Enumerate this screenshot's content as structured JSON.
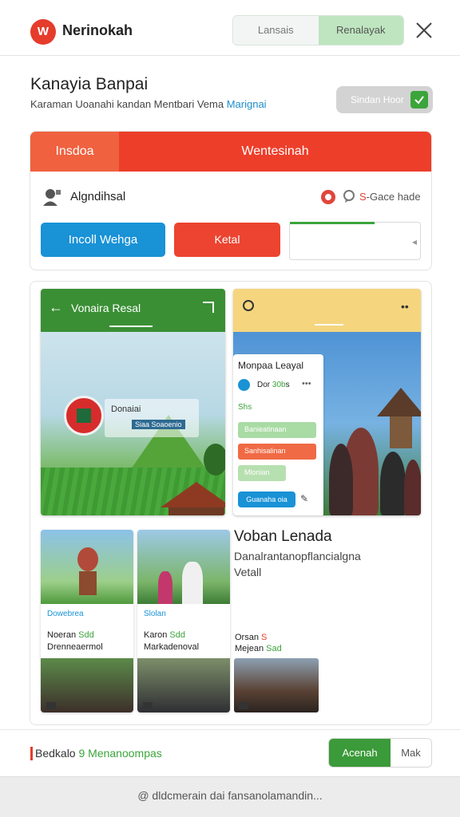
{
  "topbar": {
    "brand": "Nerinokah",
    "seg_left": "Lansais",
    "seg_right": "Renalayak"
  },
  "header": {
    "title": "Kanayia Banpai",
    "subtitle": "Karaman Uoanahi kandan Mentbari Vema",
    "subtitle_link": "Marignai",
    "toggle_label": "Sindan Hoor"
  },
  "card1": {
    "tab1": "Insdoa",
    "tab2": "Wentesinah",
    "label": "Algndihsal",
    "right_prefix": "S",
    "right_text": "Gace hade",
    "btn_blue": "Incoll Wehga",
    "btn_red": "Ketal"
  },
  "left_phone": {
    "title": "Vonaira Resal",
    "info_title": "Donaiai",
    "info_tag": "Siaa Soaoenio"
  },
  "right_phone": {
    "overlay_title": "Monpaa Leayal",
    "overlay_stat_a": "Dor",
    "overlay_stat_b": "30b",
    "overlay_stat_c": "s",
    "overlay_dots": "•••",
    "overlay_green": "Shs",
    "pb1": "Banieatinaan",
    "pb2": "Sanhisalinan",
    "pb3": "Mlonian",
    "pbtn": "Guanaha oia"
  },
  "cards": [
    {
      "badge": "Dowebrea",
      "l1_a": "Noeran",
      "l1_b": "Sdd",
      "l2": "Drenneaermol"
    },
    {
      "badge": "Slolan",
      "l1_a": "Karon",
      "l1_b": "Sdd",
      "l2": "Markadenoval"
    }
  ],
  "vb": {
    "title": "Voban Lenada",
    "sub": "Danalrantanopflancialgna",
    "sub2": "Vetall",
    "l1_a": "Orsan",
    "l1_b": "S",
    "l2_a": "Mejean",
    "l2_b": "Sad"
  },
  "actionbar": {
    "text_a": "Bedkalo",
    "text_b": "9 Menanoompas",
    "ok": "Acenah",
    "cancel": "Mak"
  },
  "footer": {
    "text": "@ dldcmerain dai fansanolamandin..."
  }
}
